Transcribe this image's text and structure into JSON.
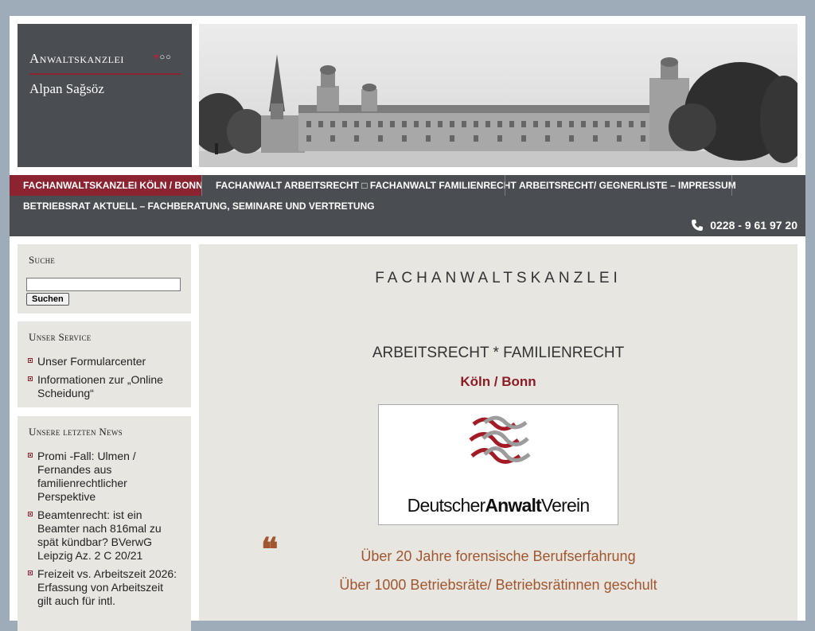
{
  "header": {
    "logo_line1": "Anwaltskanzlei",
    "logo_line2": "Alpan Sağsöz",
    "logo_marks": "♥○○"
  },
  "nav": {
    "items": [
      {
        "label": "Fachanwaltskanzlei Köln / Bonn",
        "active": true
      },
      {
        "label": "Fachanwalt Arbeitsrecht □ Fachanwalt Familienrecht",
        "active": false
      },
      {
        "label": "Arbeitsrecht/ Gegnerliste – Impressum",
        "active": false
      },
      {
        "label": "Betriebsrat aktuell – Fachberatung, Seminare und Vertretung",
        "active": false
      }
    ],
    "phone": "0228 - 9 61 97 20"
  },
  "search": {
    "title": "Suche",
    "placeholder": "",
    "button_label": "Suchen"
  },
  "service": {
    "title": "Unser Service",
    "items": [
      "Unser Formularcenter",
      "Informationen zur „Online Scheidung“"
    ]
  },
  "news": {
    "title": "Unsere letzten News",
    "items": [
      "Promi -Fall: Ulmen / Fernandes aus familienrechtlicher Perspektive",
      "Beamtenrecht: ist ein Beamter nach 816mal zu spät kündbar? BVerwG Leipzig Az. 2 C 20/21",
      "Freizeit vs. Arbeitszeit 2026: Erfassung von Arbeitszeit gilt auch für intl."
    ]
  },
  "main": {
    "title": "FACHANWALTSKANZLEI",
    "subtitle": "ARBEITSRECHT * FAMILIENRECHT",
    "city": "Köln / Bonn",
    "dav_logo": {
      "part1": "Deutscher",
      "part2": "Anwalt",
      "part3": "Verein"
    },
    "quote_mark": "❝",
    "quotes": [
      "Über 20 Jahre forensische Berufserfahrung",
      "Über 1000 Betriebsräte/ Betriebsrätinnen geschult"
    ]
  },
  "colors": {
    "accent": "#8b2430",
    "nav_bg": "#4a4e52",
    "quote": "#a0562e"
  }
}
